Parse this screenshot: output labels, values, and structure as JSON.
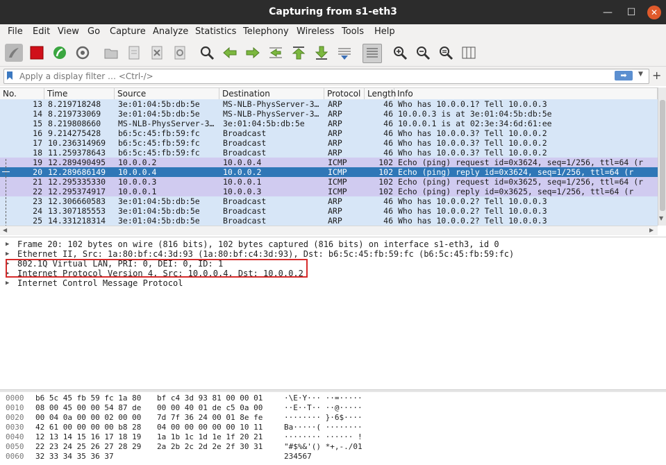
{
  "window": {
    "title": "Capturing from s1-eth3"
  },
  "menu": [
    "File",
    "Edit",
    "View",
    "Go",
    "Capture",
    "Analyze",
    "Statistics",
    "Telephony",
    "Wireless",
    "Tools",
    "Help"
  ],
  "filter": {
    "placeholder": "Apply a display filter … <Ctrl-/>"
  },
  "columns": [
    "No.",
    "Time",
    "Source",
    "Destination",
    "Protocol",
    "Length",
    "Info"
  ],
  "packets": [
    {
      "no": "13",
      "time": "8.219718248",
      "src": "3e:01:04:5b:db:5e",
      "dst": "MS-NLB-PhysServer-3…",
      "proto": "ARP",
      "len": "46",
      "info": "Who has 10.0.0.1? Tell 10.0.0.3",
      "kind": "arp"
    },
    {
      "no": "14",
      "time": "8.219733069",
      "src": "3e:01:04:5b:db:5e",
      "dst": "MS-NLB-PhysServer-3…",
      "proto": "ARP",
      "len": "46",
      "info": "10.0.0.3 is at 3e:01:04:5b:db:5e",
      "kind": "arp"
    },
    {
      "no": "15",
      "time": "8.219808660",
      "src": "MS-NLB-PhysServer-3…",
      "dst": "3e:01:04:5b:db:5e",
      "proto": "ARP",
      "len": "46",
      "info": "10.0.0.1 is at 02:3e:34:6d:61:ee",
      "kind": "arp"
    },
    {
      "no": "16",
      "time": "9.214275428",
      "src": "b6:5c:45:fb:59:fc",
      "dst": "Broadcast",
      "proto": "ARP",
      "len": "46",
      "info": "Who has 10.0.0.3? Tell 10.0.0.2",
      "kind": "arp"
    },
    {
      "no": "17",
      "time": "10.236314969",
      "src": "b6:5c:45:fb:59:fc",
      "dst": "Broadcast",
      "proto": "ARP",
      "len": "46",
      "info": "Who has 10.0.0.3? Tell 10.0.0.2",
      "kind": "arp"
    },
    {
      "no": "18",
      "time": "11.259378643",
      "src": "b6:5c:45:fb:59:fc",
      "dst": "Broadcast",
      "proto": "ARP",
      "len": "46",
      "info": "Who has 10.0.0.3? Tell 10.0.0.2",
      "kind": "arp"
    },
    {
      "no": "19",
      "time": "12.289490495",
      "src": "10.0.0.2",
      "dst": "10.0.0.4",
      "proto": "ICMP",
      "len": "102",
      "info": "Echo (ping) request  id=0x3624, seq=1/256, ttl=64 (r",
      "kind": "icmp"
    },
    {
      "no": "20",
      "time": "12.289686149",
      "src": "10.0.0.4",
      "dst": "10.0.0.2",
      "proto": "ICMP",
      "len": "102",
      "info": "Echo (ping) reply    id=0x3624, seq=1/256, ttl=64 (r",
      "kind": "selected"
    },
    {
      "no": "21",
      "time": "12.295335330",
      "src": "10.0.0.3",
      "dst": "10.0.0.1",
      "proto": "ICMP",
      "len": "102",
      "info": "Echo (ping) request  id=0x3625, seq=1/256, ttl=64 (r",
      "kind": "icmp"
    },
    {
      "no": "22",
      "time": "12.295374917",
      "src": "10.0.0.1",
      "dst": "10.0.0.3",
      "proto": "ICMP",
      "len": "102",
      "info": "Echo (ping) reply    id=0x3625, seq=1/256, ttl=64 (r",
      "kind": "icmp"
    },
    {
      "no": "23",
      "time": "12.306660583",
      "src": "3e:01:04:5b:db:5e",
      "dst": "Broadcast",
      "proto": "ARP",
      "len": "46",
      "info": "Who has 10.0.0.2? Tell 10.0.0.3",
      "kind": "arp"
    },
    {
      "no": "24",
      "time": "13.307185553",
      "src": "3e:01:04:5b:db:5e",
      "dst": "Broadcast",
      "proto": "ARP",
      "len": "46",
      "info": "Who has 10.0.0.2? Tell 10.0.0.3",
      "kind": "arp"
    },
    {
      "no": "25",
      "time": "14.331218314",
      "src": "3e:01:04:5b:db:5e",
      "dst": "Broadcast",
      "proto": "ARP",
      "len": "46",
      "info": "Who has 10.0.0.2? Tell 10.0.0.3",
      "kind": "arp"
    }
  ],
  "details": [
    "Frame 20: 102 bytes on wire (816 bits), 102 bytes captured (816 bits) on interface s1-eth3, id 0",
    "Ethernet II, Src: 1a:80:bf:c4:3d:93 (1a:80:bf:c4:3d:93), Dst: b6:5c:45:fb:59:fc (b6:5c:45:fb:59:fc)",
    "802.1Q Virtual LAN, PRI: 0, DEI: 0, ID: 1",
    "Internet Protocol Version 4, Src: 10.0.0.4, Dst: 10.0.0.2",
    "Internet Control Message Protocol"
  ],
  "hex": [
    {
      "off": "0000",
      "b1": "b6 5c 45 fb 59 fc 1a 80",
      "b2": "bf c4 3d 93 81 00 00 01",
      "ascii": "·\\E·Y··· ··=·····"
    },
    {
      "off": "0010",
      "b1": "08 00 45 00 00 54 87 de",
      "b2": "00 00 40 01 de c5 0a 00",
      "ascii": "··E··T·· ··@·····"
    },
    {
      "off": "0020",
      "b1": "00 04 0a 00 00 02 00 00",
      "b2": "7d 7f 36 24 00 01 8e fe",
      "ascii": "········ }·6$····"
    },
    {
      "off": "0030",
      "b1": "42 61 00 00 00 00 b8 28",
      "b2": "04 00 00 00 00 00 10 11",
      "ascii": "Ba·····( ········"
    },
    {
      "off": "0040",
      "b1": "12 13 14 15 16 17 18 19",
      "b2": "1a 1b 1c 1d 1e 1f 20 21",
      "ascii": "········ ······ !"
    },
    {
      "off": "0050",
      "b1": "22 23 24 25 26 27 28 29",
      "b2": "2a 2b 2c 2d 2e 2f 30 31",
      "ascii": "\"#$%&'() *+,-./01"
    },
    {
      "off": "0060",
      "b1": "32 33 34 35 36 37",
      "b2": "",
      "ascii": "234567"
    }
  ],
  "colors": {
    "arp": "#d7e6f7",
    "icmp": "#d0cbf0",
    "selected": "#2f77b7",
    "highlight": "#d62b2b"
  }
}
